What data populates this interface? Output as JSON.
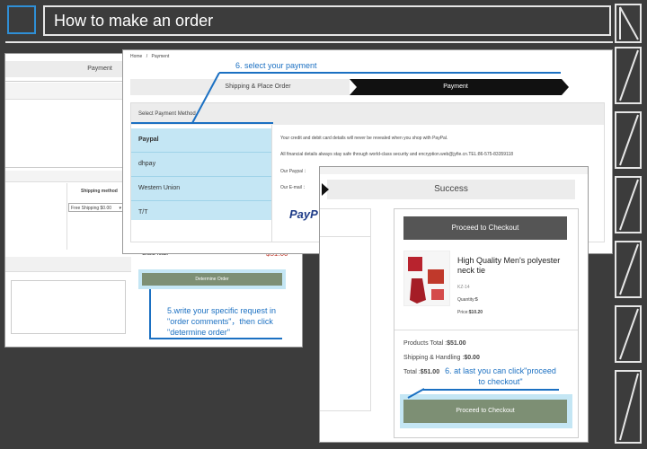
{
  "header": {
    "title": "How to make an order"
  },
  "left_pane": {
    "tab_label": "Payment",
    "shipping_method_label": "Shipping method",
    "shipping_select_value": "Free Shipping $0.00"
  },
  "payment_pane": {
    "breadcrumb_home": "Home",
    "breadcrumb_sep": "/",
    "breadcrumb_current": "Payment",
    "step1": "Shipping & Place Order",
    "step2": "Payment",
    "method_heading": "Select Payment Method",
    "methods": [
      "Paypal",
      "dhpay",
      "Western Union",
      "T/T"
    ],
    "info1": "Your credit and debit card details will never be revealed when you shop with PayPal.",
    "info2": "All financial details always stay safe through world-class security and encryption.web@jyfie.cn.TEL:86-575-83359118",
    "our_paypal": "Our Paypal ：",
    "our_email": "Our E-mail ：",
    "paypal_logo": "PayP"
  },
  "order_pane": {
    "grand_total_label": "Grand Total:",
    "grand_total_value": "$51.00",
    "determine_button": "Determine Order"
  },
  "success_pane": {
    "title": "Success",
    "proceed_top": "Proceed to Checkout",
    "product_name": "High Quality Men's polyester neck tie",
    "sku": "KZ-14",
    "quantity_label": "Quantity:",
    "quantity_value": "5",
    "price_label": "Price:",
    "price_value": "$10.20",
    "products_total_label": "Products Total :",
    "products_total_value": "$51.00",
    "shipping_label": "Shipping & Handling :",
    "shipping_value": "$0.00",
    "total_label": "Total :",
    "total_value": "$51.00",
    "proceed_bottom": "Proceed to Checkout"
  },
  "callouts": {
    "c6": "6. select your payment",
    "c5": "5.write your specific request in \"order comments\"，then click \"determine order\"",
    "c7": "6. at last you can click\"proceed to checkout\""
  },
  "colors": {
    "accent_blue": "#1b70c2",
    "header_square": "#2f8fd6",
    "method_highlight": "#c4e6f4"
  }
}
